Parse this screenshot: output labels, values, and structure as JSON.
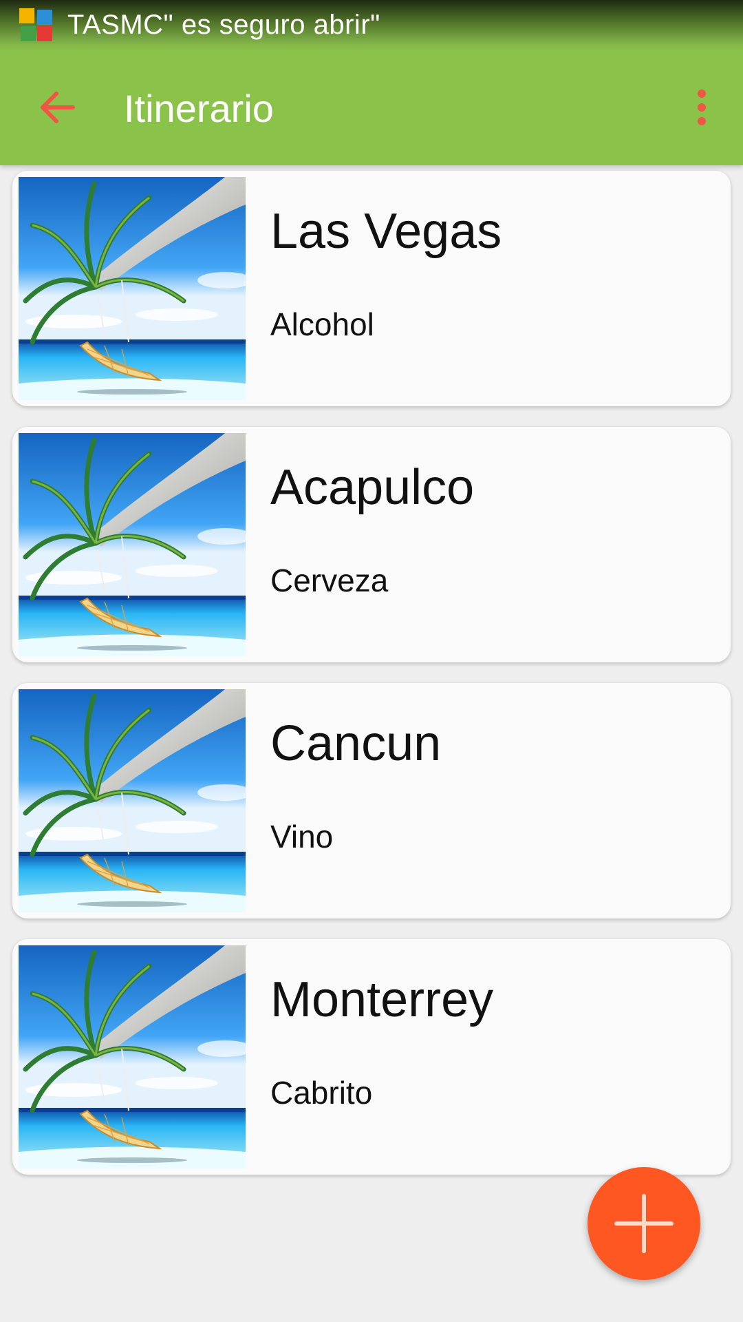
{
  "status_bar": {
    "notification_text": "TASMC\" es seguro abrir\"",
    "app_icon": "avg-shield-icon"
  },
  "toolbar": {
    "title": "Itinerario",
    "back_icon": "arrow-back-icon",
    "menu_icon": "more-vert-icon",
    "colors": {
      "background": "#8bc34a",
      "icon": "#f05545"
    }
  },
  "itinerary": {
    "items": [
      {
        "city": "Las Vegas",
        "drink": "Alcohol",
        "image": "beach-palm-hammock-image"
      },
      {
        "city": "Acapulco",
        "drink": "Cerveza",
        "image": "beach-palm-hammock-image"
      },
      {
        "city": "Cancun",
        "drink": "Vino",
        "image": "beach-palm-hammock-image"
      },
      {
        "city": "Monterrey",
        "drink": "Cabrito",
        "image": "beach-palm-hammock-image"
      }
    ]
  },
  "fab": {
    "icon": "plus-icon",
    "color": "#ff5722"
  }
}
